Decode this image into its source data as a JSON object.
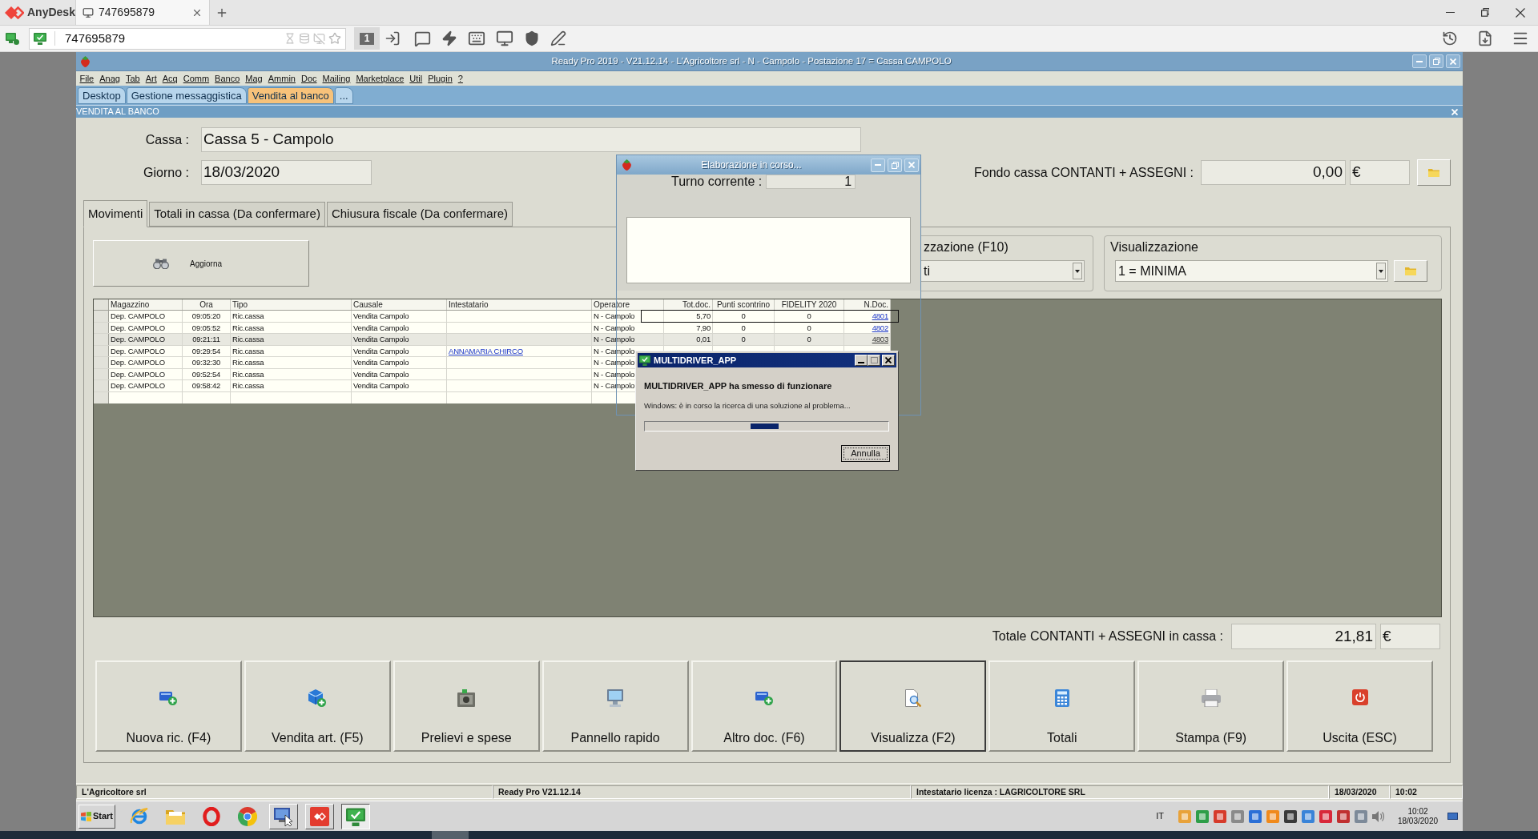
{
  "anydesk": {
    "app_name": "AnyDesk",
    "tabs": [
      {
        "label": "747695879",
        "selected": true
      }
    ],
    "address": "747695879",
    "display_button": "1"
  },
  "window": {
    "title": "Ready Pro 2019 - V21.12.14 - L'Agricoltore srl - N - Campolo - Postazione 17 = Cassa CAMPOLO"
  },
  "menu": [
    "File",
    "Anag",
    "Tab",
    "Art",
    "Acq",
    "Comm",
    "Banco",
    "Mag",
    "Ammin",
    "Doc",
    "Mailing",
    "Marketplace",
    "Util",
    "Plugin",
    "?"
  ],
  "doc_tabs": [
    {
      "label": "Desktop",
      "selected": false
    },
    {
      "label": "Gestione messaggistica",
      "selected": false
    },
    {
      "label": "Vendita al banco",
      "selected": true
    },
    {
      "label": "...",
      "selected": false
    }
  ],
  "section_title": "VENDITA AL BANCO",
  "form": {
    "cassa": {
      "label": "Cassa :",
      "value": "Cassa 5 - Campolo"
    },
    "giorno": {
      "label": "Giorno :",
      "value": "18/03/2020"
    },
    "fondo_cassa": {
      "label": "Fondo cassa CONTANTI + ASSEGNI :",
      "value": "0,00",
      "currency": "€"
    }
  },
  "tabs": [
    {
      "label": "Movimenti",
      "selected": true
    },
    {
      "label": "Totali in cassa (Da confermare)",
      "selected": false
    },
    {
      "label": "Chiusura fiscale (Da confermare)",
      "selected": false
    }
  ],
  "refresh_button": "Aggiorna",
  "filter_group": {
    "label": "zzazione (F10)",
    "value": "ti"
  },
  "view_group": {
    "label": "Visualizzazione",
    "value": "1 = MINIMA"
  },
  "table": {
    "columns": [
      {
        "label": "Magazzino",
        "kind": "text"
      },
      {
        "label": "Ora",
        "kind": "text"
      },
      {
        "label": "Tipo",
        "kind": "text"
      },
      {
        "label": "Causale",
        "kind": "text"
      },
      {
        "label": "Intestatario",
        "kind": "link"
      },
      {
        "label": "Operatore",
        "kind": "text"
      },
      {
        "label": "Tot.doc.",
        "kind": "text"
      },
      {
        "label": "Punti scontrino",
        "kind": "text"
      },
      {
        "label": "FIDELITY 2020",
        "kind": "text"
      },
      {
        "label": "N.Doc.",
        "kind": "link"
      }
    ],
    "rows": [
      {
        "cells": [
          "Dep. CAMPOLO",
          "09:05:20",
          "Ric.cassa",
          "Vendita Campolo",
          null,
          "N - Campolo",
          "5,70",
          "0",
          "0",
          "4801"
        ],
        "selected": false
      },
      {
        "cells": [
          "Dep. CAMPOLO",
          "09:05:52",
          "Ric.cassa",
          "Vendita Campolo",
          null,
          "N - Campolo",
          "7,90",
          "0",
          "0",
          "4802"
        ],
        "selected": false
      },
      {
        "cells": [
          "Dep. CAMPOLO",
          "09:21:11",
          "Ric.cassa",
          "Vendita Campolo",
          null,
          "N - Campolo",
          "0,01",
          "0",
          "0",
          "4803"
        ],
        "selected": true
      },
      {
        "cells": [
          "Dep. CAMPOLO",
          "09:29:54",
          "Ric.cassa",
          "Vendita Campolo",
          "ANNAMARIA CHIRCO",
          "N - Campolo",
          null,
          null,
          null,
          null
        ],
        "selected": false
      },
      {
        "cells": [
          "Dep. CAMPOLO",
          "09:32:30",
          "Ric.cassa",
          "Vendita Campolo",
          null,
          "N - Campolo",
          null,
          null,
          null,
          null
        ],
        "selected": false
      },
      {
        "cells": [
          "Dep. CAMPOLO",
          "09:52:54",
          "Ric.cassa",
          "Vendita Campolo",
          null,
          "N - Campolo",
          null,
          null,
          null,
          null
        ],
        "selected": false
      },
      {
        "cells": [
          "Dep. CAMPOLO",
          "09:58:42",
          "Ric.cassa",
          "Vendita Campolo",
          null,
          "N - Campolo",
          null,
          null,
          null,
          null
        ],
        "selected": false
      }
    ]
  },
  "total": {
    "label": "Totale CONTANTI + ASSEGNI in cassa :",
    "value": "21,81",
    "currency": "€"
  },
  "actions": [
    {
      "label": "Nuova ric. (F4)",
      "kind": "new_receipt",
      "focused": false
    },
    {
      "label": "Vendita art. (F5)",
      "kind": "sale",
      "focused": false
    },
    {
      "label": "Prelievi e spese",
      "kind": "withdrawal",
      "focused": false
    },
    {
      "label": "Pannello rapido",
      "kind": "panel",
      "focused": false
    },
    {
      "label": "Altro doc. (F6)",
      "kind": "other_doc",
      "focused": false
    },
    {
      "label": "Visualizza (F2)",
      "kind": "view",
      "focused": true
    },
    {
      "label": "Totali",
      "kind": "totals",
      "focused": false
    },
    {
      "label": "Stampa (F9)",
      "kind": "print",
      "focused": false
    },
    {
      "label": "Uscita (ESC)",
      "kind": "exit",
      "focused": false
    }
  ],
  "status_bar": [
    "L'Agricoltore srl",
    "Ready Pro V21.12.14",
    "Intestatario licenza : LAGRICOLTORE SRL",
    "18/03/2020",
    "10:02"
  ],
  "taskbar": {
    "start": "Start",
    "apps": [
      {
        "kind": "swoosh",
        "running": false,
        "selected": false
      },
      {
        "kind": "folder",
        "running": false,
        "selected": false
      },
      {
        "kind": "ring",
        "running": false,
        "selected": false
      },
      {
        "kind": "tricolor",
        "running": false,
        "selected": false
      },
      {
        "kind": "monitor_cursor",
        "running": true,
        "selected": false
      },
      {
        "kind": "diamond",
        "running": true,
        "selected": false
      },
      {
        "kind": "monitor_check",
        "running": true,
        "selected": true
      }
    ],
    "language": "IT",
    "time": "10:02",
    "date": "18/03/2020"
  },
  "processing_dialog": {
    "title": "Elaborazione in corso...",
    "field_label": "Turno corrente :",
    "field_value": "1"
  },
  "error_dialog": {
    "title": "MULTIDRIVER_APP",
    "heading": "MULTIDRIVER_APP ha smesso di funzionare",
    "message": "Windows: è in corso la ricerca di una soluzione al problema...",
    "progress": {
      "indeterminate": true
    },
    "button": "Annulla"
  }
}
